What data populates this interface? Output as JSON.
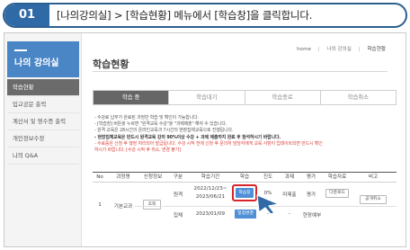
{
  "banner": {
    "step": "01",
    "instruction": "[나의강의실] > [학습현황] 메뉴에서 [학습창]을 클릭합니다."
  },
  "sidebar": {
    "title": "나의 강의실",
    "items": [
      {
        "label": "학습현황",
        "active": true
      },
      {
        "label": "입교공문 출력"
      },
      {
        "label": "계산서 및 영수증 출력"
      },
      {
        "label": "개인정보수정"
      },
      {
        "label": "나의 Q&A"
      }
    ]
  },
  "breadcrumb": {
    "home": "home",
    "level1": "나의 강의실",
    "level2": "학습현황"
  },
  "page_title": "학습현황",
  "tabs": [
    {
      "label": "학습 중",
      "active": true
    },
    {
      "label": "학습대기"
    },
    {
      "label": "학습종료"
    },
    {
      "label": "학습취소"
    }
  ],
  "notice": {
    "lines": [
      "- 수강료 납부가 완료된 과정만 학습 및 확인이 가능합니다.",
      "- [학습창] 버튼을 누르면 \"원격교육 수강\"을 \"과제제출\" 해야 수 있습니다.",
      "- 원격 교육은 28시간의 온라인교육과 7시간의 현장집체교육으로 진행됩니다."
    ],
    "bold_line": "- 현장집체교육은 반드시 원격교육 강의 90%이상 수강 + 과제 제출까지 완료 후 참석하시기 바랍니다.",
    "red_lines": [
      "- 수료증은 신청 후 행정 처리되어 발급됩니다. 수강 시작 전에 신청 후 문의처 담당자에게 교육 사항이 업데이트되면 반드시 확인",
      "  하시기 바랍니다. [수강 시작 후 취소, 변경 불가]"
    ]
  },
  "table": {
    "headers": [
      "No",
      "과정명",
      "신청정보",
      "구분",
      "학습기간",
      "학습",
      "진도",
      "과제",
      "평가",
      "학습자료",
      "비고"
    ],
    "row": {
      "no": "1",
      "course": "기본교과",
      "info_button": "조회",
      "online": {
        "type": "원격",
        "period_start": "2022/12/23~",
        "period_end": "2023/06/21",
        "study_button": "학습창",
        "progress": "0%",
        "assignment": "미제출",
        "evaluation": "평가",
        "material_button": "다운로드",
        "note_button": "공개취소"
      },
      "offline": {
        "type": "집체",
        "period": "2023/01/09",
        "status_button": "일정변경",
        "progress": "-",
        "assignment": "-",
        "evaluation": "현장예부"
      }
    }
  },
  "colors": {
    "accent": "#4a86c6",
    "banner": "#2f6aa6",
    "highlight": "#d8242a",
    "warning_text": "#d9413a"
  }
}
